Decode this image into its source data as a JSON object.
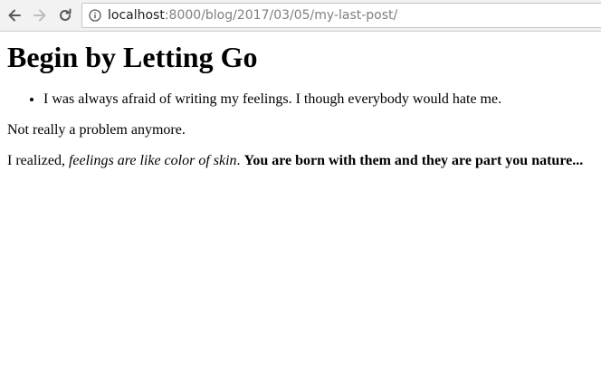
{
  "browser": {
    "url_host": "localhost",
    "url_path": ":8000/blog/2017/03/05/my-last-post/"
  },
  "post": {
    "title": "Begin by Letting Go",
    "list_items": [
      "I was always afraid of writing my feelings. I though everybody would hate me."
    ],
    "paragraph_1": "Not really a problem anymore.",
    "paragraph_2": {
      "lead": "I realized, ",
      "emphasis": "feelings are like color of skin",
      "middle": ". ",
      "strong": "You are born with them and they are part you nature..."
    }
  }
}
